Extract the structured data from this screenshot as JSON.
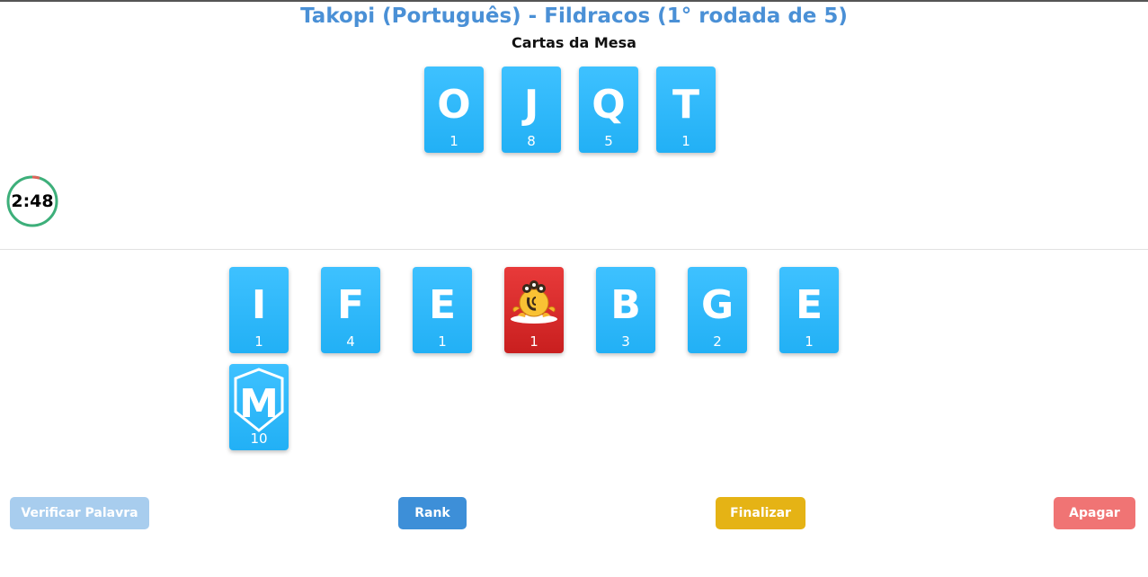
{
  "header": {
    "title": "Takopi (Português) - Fildracos (1° rodada de 5)",
    "subtitle": "Cartas da Mesa"
  },
  "timer": {
    "text": "2:48",
    "ring_color": "#3daf7a",
    "elapsed_color": "#e0635a"
  },
  "table_cards": [
    {
      "letter": "O",
      "points": "1"
    },
    {
      "letter": "J",
      "points": "8"
    },
    {
      "letter": "Q",
      "points": "5"
    },
    {
      "letter": "T",
      "points": "1"
    }
  ],
  "hand_cards": [
    {
      "letter": "I",
      "points": "1"
    },
    {
      "letter": "F",
      "points": "4"
    },
    {
      "letter": "E",
      "points": "1"
    },
    {
      "letter": "",
      "points": "1",
      "type": "mascot",
      "icon": "takopi-mascot-icon"
    },
    {
      "letter": "B",
      "points": "3"
    },
    {
      "letter": "G",
      "points": "2"
    },
    {
      "letter": "E",
      "points": "1"
    },
    {
      "letter": "M",
      "points": "10",
      "type": "shield",
      "icon": "shield-icon"
    }
  ],
  "buttons": {
    "verify": "Verificar Palavra",
    "rank": "Rank",
    "finish": "Finalizar",
    "clear": "Apagar"
  },
  "colors": {
    "title": "#4a90d6",
    "card": "#2fb9fb",
    "special_card": "#d82a2a",
    "verify": "#a8cdee",
    "rank": "#3d8fd8",
    "finish": "#e5b315",
    "clear": "#f07474"
  }
}
